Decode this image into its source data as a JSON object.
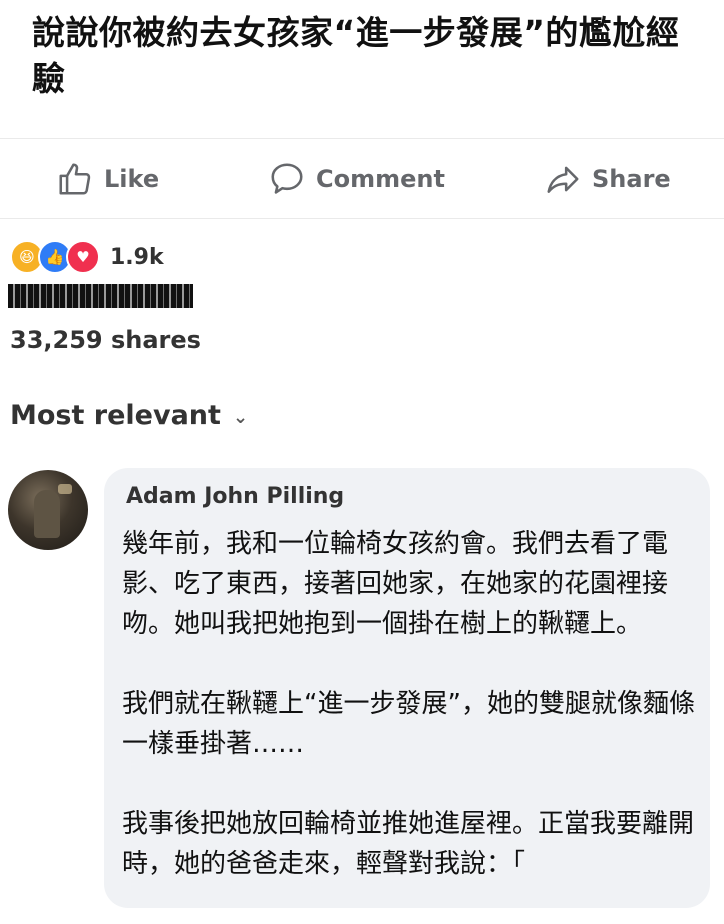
{
  "headline": "說說你被約去女孩家“進一步發展”的尷尬經驗",
  "actions": {
    "like_label": "Like",
    "comment_label": "Comment",
    "share_label": "Share"
  },
  "reactions": {
    "icons": [
      "haha-icon",
      "like-icon",
      "love-icon"
    ],
    "count": "1.9k"
  },
  "shares": "33,259 shares",
  "sort": {
    "label": "Most relevant"
  },
  "comment": {
    "author": "Adam John Pilling",
    "paragraphs": [
      "幾年前，我和一位輪椅女孩約會。我們去看了電影、吃了東西，接著回她家，在她家的花園裡接吻。她叫我把她抱到一個掛在樹上的鞦韆上。",
      "我們就在鞦韆上“進一步發展”，她的雙腿就像麵條一樣垂掛著……",
      "我事後把她放回輪椅並推她進屋裡。正當我要離開時，她的爸爸走來，輕聲對我說：「"
    ]
  },
  "colors": {
    "action_gray": "#65676b",
    "bubble_bg": "#f0f2f5",
    "like_blue": "#2f7cf6",
    "love_red": "#f0304f",
    "haha_yellow": "#f7b125"
  }
}
